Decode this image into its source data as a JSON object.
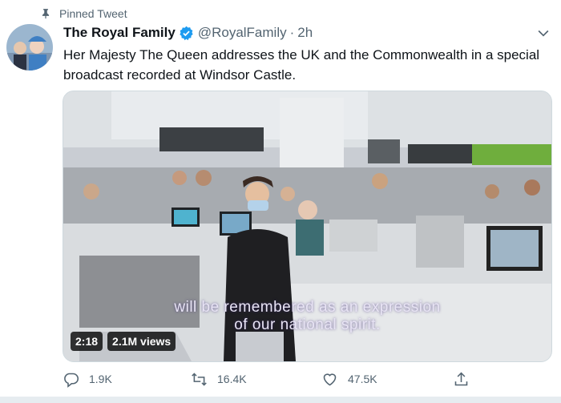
{
  "tweet": {
    "pinned_label": "Pinned Tweet",
    "display_name": "The Royal Family",
    "handle": "@RoyalFamily",
    "separator": "·",
    "time": "2h",
    "text": "Her Majesty The Queen addresses the UK and the Commonwealth in a special broadcast recorded at Windsor Castle.",
    "verified_color": "#1d9bf0"
  },
  "media": {
    "duration": "2:18",
    "views": "2.1M views",
    "caption_line1": "will be remembered as an expression",
    "caption_line2": "of our national spirit."
  },
  "actions": {
    "replies": "1.9K",
    "retweets": "16.4K",
    "likes": "47.5K"
  },
  "icons": [
    "pin-icon",
    "verified-badge-icon",
    "chevron-down-icon",
    "reply-icon",
    "retweet-icon",
    "like-icon",
    "share-icon"
  ]
}
